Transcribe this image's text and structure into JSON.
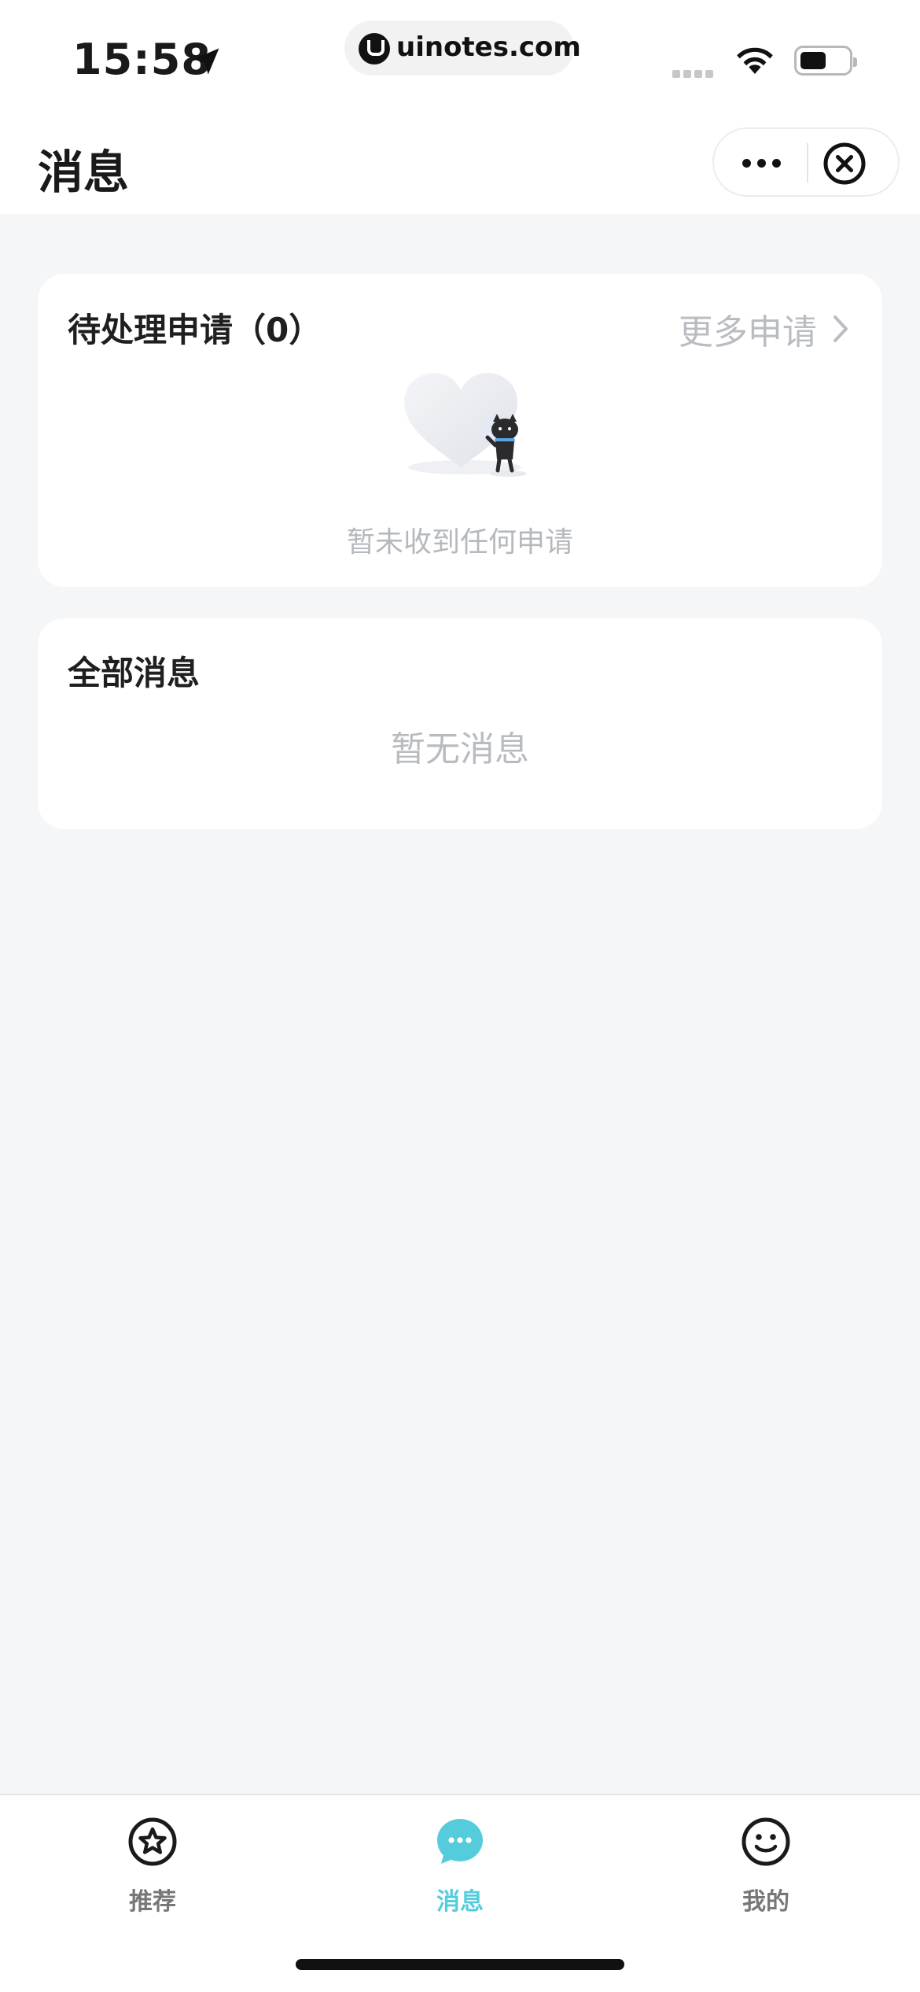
{
  "status_bar": {
    "time": "15:58",
    "url": "uinotes.com"
  },
  "header": {
    "title": "消息"
  },
  "pending": {
    "title": "待处理申请（0）",
    "more_label": "更多申请",
    "empty_text": "暂未收到任何申请"
  },
  "all_messages": {
    "title": "全部消息",
    "empty_text": "暂无消息"
  },
  "tabs": [
    {
      "label": "推荐",
      "icon": "star-circle-icon",
      "active": false
    },
    {
      "label": "消息",
      "icon": "chat-bubble-icon",
      "active": true
    },
    {
      "label": "我的",
      "icon": "smiley-icon",
      "active": false
    }
  ],
  "colors": {
    "accent": "#55ccdc",
    "muted_text": "#b8bcc1",
    "background": "#f5f6f8"
  }
}
